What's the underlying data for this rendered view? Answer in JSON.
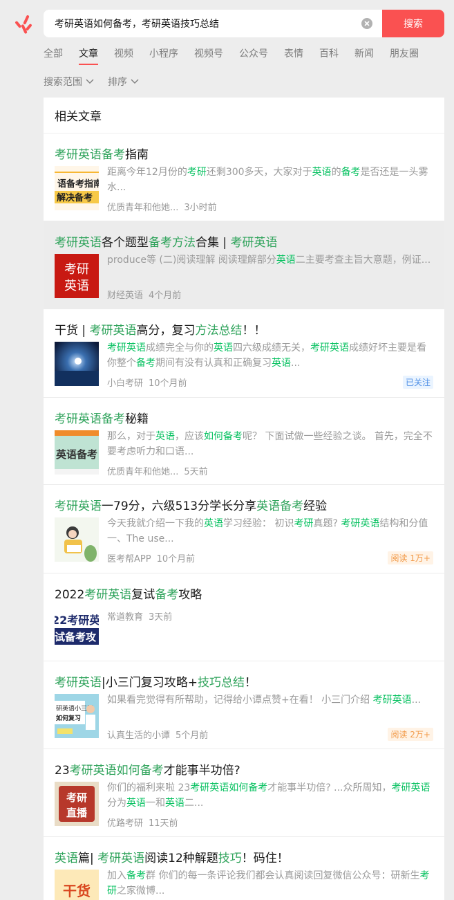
{
  "search": {
    "query": "考研英语如何备考，考研英语技巧总结",
    "button": "搜索"
  },
  "tabs": [
    "全部",
    "文章",
    "视频",
    "小程序",
    "视频号",
    "公众号",
    "表情",
    "百科",
    "新闻",
    "朋友圈"
  ],
  "active_tab": "文章",
  "filters": [
    "搜索范围",
    "排序"
  ],
  "section_title": "相关文章",
  "articles": [
    {
      "title": "考研英语备考指南",
      "snippet": "距离今年12月份的考研还剩300多天，大家对于英语的备考是否还是一头雾水...",
      "source": "优质青年和他她...",
      "time": "3小时前",
      "thumb_text": "英语备考指南 解决备考"
    },
    {
      "title": "考研英语各个题型备考方法合集 | 考研英语",
      "snippet": "produce等 (二)阅读理解 阅读理解部分英语二主要考查主旨大意题，例证...",
      "source": "财经英语",
      "time": "4个月前",
      "thumb_text": "考研英语"
    },
    {
      "title": "干货 | 考研英语高分，复习方法总结！！",
      "snippet": "考研英语成绩完全与你的英语四六级成绩无关，考研英语成绩好坏主要是看你整个备考期间有没有认真和正确复习英语...",
      "source": "小白考研",
      "time": "10个月前",
      "badge": "已关注"
    },
    {
      "title": "考研英语备考秘籍",
      "snippet": "那么，对于英语，应该如何备考呢？ 下面试做一些经验之谈。 首先，完全不要考虑听力和口语...",
      "source": "优质青年和他她...",
      "time": "5天前",
      "thumb_text": "英语备考"
    },
    {
      "title": "考研英语一79分，六级513分学长分享英语备考经验",
      "snippet": "今天我就介绍一下我的英语学习经验： 初识考研真题? 考研英语结构和分值 一、The use...",
      "source": "医考帮APP",
      "time": "10个月前",
      "badge": "阅读 1万+"
    },
    {
      "title": "2022考研英语复试备考攻略",
      "snippet": "",
      "source": "常道教育",
      "time": "3天前",
      "thumb_text": "22考研英 试备考攻"
    },
    {
      "title": "考研英语|小三门复习攻略+技巧总结！",
      "snippet": "如果看完觉得有所帮助，记得给小谭点赞+在看！ 小三门介绍 考研英语...",
      "source": "认真生活的小谭",
      "time": "5个月前",
      "badge": "阅读 2万+",
      "thumb_text": "研英语小三门 如何复习"
    },
    {
      "title": "23考研英语如何备考才能事半功倍?",
      "snippet": "你们的福利来啦 23考研英语如何备考才能事半功倍? ...众所周知，考研英语分为英语一和英语二...",
      "source": "优路考研",
      "time": "11天前",
      "thumb_text": "考研直播"
    },
    {
      "title": "英语篇| 考研英语阅读12种解题技巧！码住！",
      "snippet": "加入备考群 你们的每一条评论我们都会认真阅读回复微信公众号：研新生考研之家微博...",
      "source": "",
      "time": "",
      "thumb_text": "干货"
    }
  ],
  "colors": {
    "accent": "#fa5151",
    "highlight": "#07c160",
    "follow_badge": "#4e8fe6",
    "read_badge": "#f29b4a"
  }
}
